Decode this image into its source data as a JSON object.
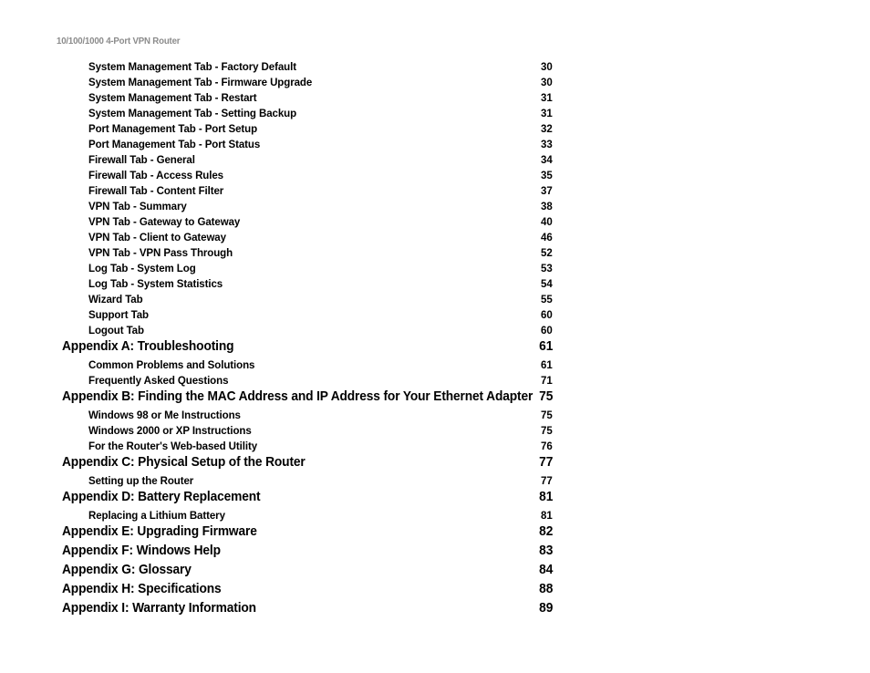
{
  "header": {
    "running_title": "10/100/1000 4-Port VPN Router"
  },
  "toc": {
    "entries": [
      {
        "level": 2,
        "title": "System Management Tab - Factory Default",
        "page": "30"
      },
      {
        "level": 2,
        "title": "System Management Tab - Firmware Upgrade",
        "page": "30"
      },
      {
        "level": 2,
        "title": "System Management Tab - Restart",
        "page": "31"
      },
      {
        "level": 2,
        "title": "System Management Tab - Setting Backup",
        "page": "31"
      },
      {
        "level": 2,
        "title": "Port Management Tab - Port Setup",
        "page": "32"
      },
      {
        "level": 2,
        "title": "Port Management Tab - Port Status",
        "page": "33"
      },
      {
        "level": 2,
        "title": "Firewall Tab - General",
        "page": "34"
      },
      {
        "level": 2,
        "title": "Firewall Tab - Access Rules",
        "page": "35"
      },
      {
        "level": 2,
        "title": "Firewall Tab - Content Filter",
        "page": "37"
      },
      {
        "level": 2,
        "title": "VPN Tab - Summary",
        "page": "38"
      },
      {
        "level": 2,
        "title": "VPN Tab - Gateway to Gateway",
        "page": "40"
      },
      {
        "level": 2,
        "title": "VPN Tab - Client to Gateway",
        "page": "46"
      },
      {
        "level": 2,
        "title": "VPN Tab - VPN Pass Through",
        "page": "52"
      },
      {
        "level": 2,
        "title": "Log Tab - System Log",
        "page": "53"
      },
      {
        "level": 2,
        "title": "Log Tab - System Statistics",
        "page": "54"
      },
      {
        "level": 2,
        "title": "Wizard Tab",
        "page": "55"
      },
      {
        "level": 2,
        "title": "Support Tab",
        "page": "60"
      },
      {
        "level": 2,
        "title": "Logout Tab",
        "page": "60"
      },
      {
        "level": 1,
        "title": "Appendix A: Troubleshooting",
        "page": "61"
      },
      {
        "level": 2,
        "title": "Common Problems and Solutions",
        "page": "61"
      },
      {
        "level": 2,
        "title": "Frequently Asked Questions",
        "page": "71"
      },
      {
        "level": 1,
        "title": "Appendix B: Finding the MAC Address and IP Address for Your Ethernet Adapter",
        "page": "75"
      },
      {
        "level": 2,
        "title": "Windows 98 or Me Instructions",
        "page": "75"
      },
      {
        "level": 2,
        "title": "Windows 2000 or XP Instructions",
        "page": "75"
      },
      {
        "level": 2,
        "title": "For the Router's Web-based Utility",
        "page": "76"
      },
      {
        "level": 1,
        "title": "Appendix C: Physical Setup of the Router",
        "page": "77"
      },
      {
        "level": 2,
        "title": "Setting up the Router",
        "page": "77"
      },
      {
        "level": 1,
        "title": "Appendix D: Battery Replacement",
        "page": "81"
      },
      {
        "level": 2,
        "title": "Replacing a Lithium Battery",
        "page": "81"
      },
      {
        "level": 1,
        "title": "Appendix E: Upgrading Firmware",
        "page": "82"
      },
      {
        "level": 1,
        "title": "Appendix F: Windows Help",
        "page": "83"
      },
      {
        "level": 1,
        "title": "Appendix G: Glossary",
        "page": "84"
      },
      {
        "level": 1,
        "title": "Appendix H: Specifications",
        "page": "88"
      },
      {
        "level": 1,
        "title": "Appendix I: Warranty Information",
        "page": "89"
      }
    ]
  }
}
